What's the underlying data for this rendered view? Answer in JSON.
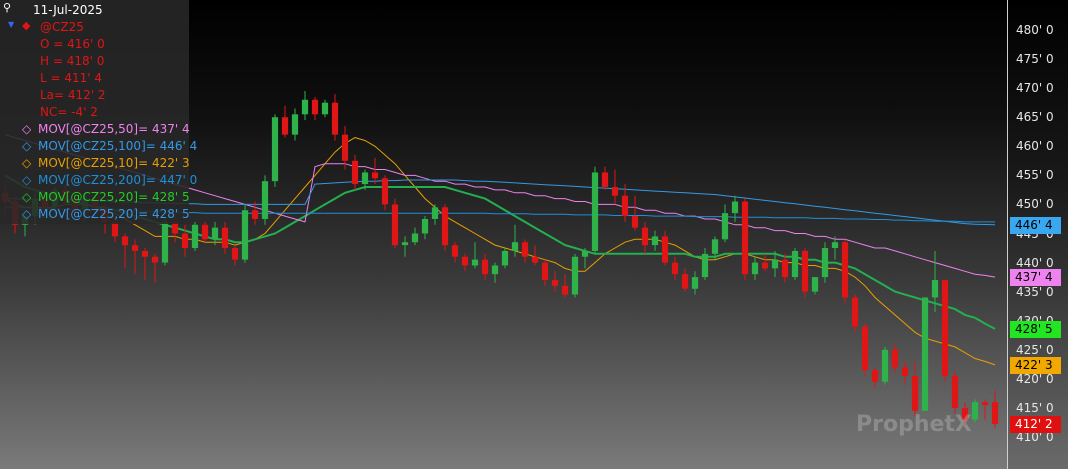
{
  "legend": {
    "date": "11-Jul-2025",
    "symbol": "@CZ25",
    "open": "O = 416' 0",
    "high": "H = 418' 0",
    "low": "L = 411' 4",
    "last": "La= 412' 2",
    "net_change": "NC= -4' 2",
    "studies": [
      {
        "label": "MOV[@CZ25,50]= 437' 4",
        "color": "#ee82ee"
      },
      {
        "label": "MOV[@CZ25,100]= 446' 4",
        "color": "#3399e6"
      },
      {
        "label": "MOV[@CZ25,10]= 422' 3",
        "color": "#e8a000"
      },
      {
        "label": "MOV[@CZ25,200]= 447' 0",
        "color": "#1e8fd8"
      },
      {
        "label": "MOV[@CZ25,20]= 428' 5",
        "color": "#22cc22"
      },
      {
        "label": "MOV[@CZ25,20]= 428' 5",
        "color": "#3399e6"
      }
    ]
  },
  "axis_tags": [
    {
      "text": "446' 4",
      "value": 446.5,
      "bg": "#3aa8f0",
      "fg": "#000000"
    },
    {
      "text": "437' 4",
      "value": 437.5,
      "bg": "#ee82ee",
      "fg": "#000000"
    },
    {
      "text": "428' 5",
      "value": 428.6,
      "bg": "#22e622",
      "fg": "#000000"
    },
    {
      "text": "422' 3",
      "value": 422.4,
      "bg": "#f2a800",
      "fg": "#000000"
    },
    {
      "text": "412' 2",
      "value": 412.25,
      "bg": "#e01010",
      "fg": "#ffffff"
    }
  ],
  "watermark": "ProphetX",
  "colors": {
    "up": "#2db34a",
    "down": "#e01515",
    "ma10": "#e8a000",
    "ma20": "#22b050",
    "ma50": "#ee82ee",
    "ma100": "#3399e6",
    "ma200": "#1e8fd8"
  },
  "chart_data": {
    "type": "candlestick",
    "symbol": "@CZ25",
    "ylim": [
      407,
      486
    ],
    "y_ticks": [
      "480' 0",
      "475' 0",
      "470' 0",
      "465' 0",
      "460' 0",
      "455' 0",
      "450' 0",
      "445' 0",
      "440' 0",
      "435' 0",
      "430' 0",
      "425' 0",
      "420' 0",
      "415' 0",
      "410' 0"
    ],
    "y_tick_values": [
      480,
      475,
      470,
      465,
      460,
      455,
      450,
      445,
      440,
      435,
      430,
      425,
      420,
      415,
      410
    ],
    "last_bar": {
      "date": "11-Jul-2025",
      "open": 416.0,
      "high": 418.0,
      "low": 411.5,
      "close": 412.25
    },
    "candles": [
      [
        452.0,
        454.0,
        448.0,
        450.5
      ],
      [
        450.5,
        451.5,
        445.0,
        446.5
      ],
      [
        446.5,
        449.0,
        444.5,
        448.0
      ],
      [
        448.0,
        452.0,
        446.5,
        451.0
      ],
      [
        451.0,
        452.5,
        449.0,
        449.5
      ],
      [
        449.5,
        453.0,
        448.5,
        452.5
      ],
      [
        452.5,
        453.5,
        450.0,
        451.0
      ],
      [
        451.0,
        451.5,
        448.0,
        449.0
      ],
      [
        449.0,
        452.0,
        447.0,
        451.0
      ],
      [
        451.0,
        451.5,
        447.5,
        449.5
      ],
      [
        449.5,
        450.0,
        445.0,
        447.0
      ],
      [
        447.0,
        448.0,
        443.5,
        444.5
      ],
      [
        444.5,
        445.0,
        439.0,
        443.0
      ],
      [
        443.0,
        444.0,
        438.0,
        442.0
      ],
      [
        442.0,
        442.5,
        437.0,
        441.0
      ],
      [
        441.0,
        441.5,
        436.5,
        440.0
      ],
      [
        440.0,
        447.5,
        439.5,
        447.0
      ],
      [
        447.0,
        448.5,
        443.5,
        445.0
      ],
      [
        445.0,
        446.5,
        441.0,
        442.5
      ],
      [
        442.5,
        447.0,
        442.0,
        446.5
      ],
      [
        446.5,
        447.0,
        443.5,
        444.0
      ],
      [
        444.0,
        447.0,
        443.0,
        446.0
      ],
      [
        446.0,
        447.0,
        441.5,
        442.5
      ],
      [
        442.5,
        443.0,
        439.5,
        440.5
      ],
      [
        440.5,
        450.0,
        440.0,
        449.0
      ],
      [
        449.0,
        450.5,
        446.5,
        447.5
      ],
      [
        447.5,
        455.0,
        446.5,
        454.0
      ],
      [
        454.0,
        465.5,
        453.0,
        465.0
      ],
      [
        465.0,
        467.0,
        461.5,
        462.0
      ],
      [
        462.0,
        466.5,
        461.0,
        465.5
      ],
      [
        465.5,
        469.5,
        464.5,
        468.0
      ],
      [
        468.0,
        468.5,
        464.5,
        465.5
      ],
      [
        465.5,
        468.0,
        465.0,
        467.5
      ],
      [
        467.5,
        469.0,
        461.0,
        462.0
      ],
      [
        462.0,
        463.5,
        456.0,
        457.5
      ],
      [
        457.5,
        458.5,
        452.5,
        453.5
      ],
      [
        453.5,
        456.0,
        452.5,
        455.5
      ],
      [
        455.5,
        458.0,
        453.5,
        454.5
      ],
      [
        454.5,
        455.0,
        449.0,
        450.0
      ],
      [
        450.0,
        451.0,
        442.5,
        443.0
      ],
      [
        443.0,
        444.5,
        441.0,
        443.5
      ],
      [
        443.5,
        446.0,
        443.0,
        445.0
      ],
      [
        445.0,
        448.0,
        444.0,
        447.5
      ],
      [
        447.5,
        450.0,
        446.5,
        449.5
      ],
      [
        449.5,
        450.0,
        442.0,
        443.0
      ],
      [
        443.0,
        443.5,
        440.0,
        441.0
      ],
      [
        441.0,
        441.5,
        438.5,
        439.5
      ],
      [
        439.5,
        443.5,
        439.0,
        440.5
      ],
      [
        440.5,
        441.5,
        437.0,
        438.0
      ],
      [
        438.0,
        440.0,
        436.5,
        439.5
      ],
      [
        439.5,
        442.5,
        439.0,
        442.0
      ],
      [
        442.0,
        446.5,
        441.0,
        443.5
      ],
      [
        443.5,
        444.0,
        440.0,
        441.0
      ],
      [
        441.0,
        443.0,
        439.5,
        440.0
      ],
      [
        440.0,
        440.5,
        436.0,
        437.0
      ],
      [
        437.0,
        438.5,
        435.0,
        436.0
      ],
      [
        436.0,
        438.0,
        434.0,
        434.5
      ],
      [
        434.5,
        441.5,
        434.0,
        441.0
      ],
      [
        441.0,
        442.5,
        439.0,
        442.0
      ],
      [
        442.0,
        456.5,
        441.5,
        455.5
      ],
      [
        455.5,
        456.5,
        452.5,
        453.0
      ],
      [
        453.0,
        456.0,
        450.0,
        451.5
      ],
      [
        451.5,
        453.5,
        447.0,
        448.0
      ],
      [
        448.0,
        451.5,
        445.5,
        446.0
      ],
      [
        446.0,
        447.0,
        441.5,
        443.0
      ],
      [
        443.0,
        445.5,
        442.0,
        444.5
      ],
      [
        444.5,
        445.5,
        439.5,
        440.0
      ],
      [
        440.0,
        441.0,
        437.0,
        438.0
      ],
      [
        438.0,
        439.0,
        435.0,
        435.5
      ],
      [
        435.5,
        438.5,
        434.5,
        437.5
      ],
      [
        437.5,
        442.5,
        437.0,
        441.5
      ],
      [
        441.5,
        444.5,
        440.5,
        444.0
      ],
      [
        444.0,
        450.0,
        443.5,
        448.5
      ],
      [
        448.5,
        451.5,
        447.0,
        450.5
      ],
      [
        450.5,
        451.0,
        437.0,
        438.0
      ],
      [
        438.0,
        441.0,
        437.0,
        440.0
      ],
      [
        440.0,
        441.5,
        438.5,
        439.0
      ],
      [
        439.0,
        442.0,
        437.5,
        440.5
      ],
      [
        440.5,
        441.5,
        436.5,
        437.5
      ],
      [
        437.5,
        442.5,
        437.0,
        442.0
      ],
      [
        442.0,
        442.5,
        434.0,
        435.0
      ],
      [
        435.0,
        437.5,
        434.5,
        437.5
      ],
      [
        437.5,
        443.5,
        436.5,
        442.5
      ],
      [
        442.5,
        444.5,
        440.5,
        443.5
      ],
      [
        443.5,
        444.0,
        433.0,
        434.0
      ],
      [
        434.0,
        434.5,
        428.0,
        429.0
      ],
      [
        429.0,
        429.5,
        420.5,
        421.5
      ],
      [
        421.5,
        422.0,
        418.5,
        419.5
      ],
      [
        419.5,
        425.5,
        419.0,
        425.0
      ],
      [
        425.0,
        426.0,
        421.0,
        422.0
      ],
      [
        422.0,
        423.0,
        419.0,
        420.5
      ],
      [
        420.5,
        423.0,
        413.5,
        414.5
      ],
      [
        414.5,
        432.5,
        416.5,
        434.0
      ],
      [
        434.0,
        442.0,
        431.5,
        437.0
      ],
      [
        437.0,
        429.0,
        419.5,
        420.5
      ],
      [
        420.5,
        421.5,
        414.0,
        415.0
      ],
      [
        415.0,
        416.0,
        412.0,
        413.0
      ],
      [
        413.0,
        416.5,
        412.5,
        416.0
      ],
      [
        416.0,
        416.5,
        413.0,
        415.5
      ],
      [
        416.0,
        418.0,
        411.5,
        412.25
      ]
    ],
    "series": [
      {
        "name": "MOV[@CZ25,10]",
        "values": [
          451.0,
          450.0,
          449.5,
          449.5,
          449.5,
          449.5,
          450.0,
          450.0,
          450.0,
          449.5,
          449.0,
          448.5,
          447.5,
          446.5,
          445.5,
          444.5,
          444.5,
          444.5,
          444.0,
          444.0,
          443.5,
          443.5,
          443.5,
          443.0,
          443.5,
          444.0,
          445.0,
          447.0,
          449.0,
          451.0,
          453.0,
          455.0,
          457.0,
          459.0,
          460.5,
          461.5,
          461.0,
          460.0,
          458.5,
          457.0,
          455.0,
          453.0,
          451.0,
          449.5,
          448.0,
          447.0,
          446.0,
          445.0,
          444.0,
          443.0,
          442.5,
          442.0,
          441.5,
          441.0,
          440.5,
          440.0,
          439.0,
          438.5,
          438.5,
          440.0,
          441.5,
          442.5,
          443.5,
          444.0,
          444.0,
          444.0,
          443.5,
          443.0,
          442.0,
          441.0,
          440.5,
          440.5,
          441.0,
          441.5,
          441.5,
          441.0,
          440.5,
          440.5,
          440.0,
          440.0,
          439.5,
          439.5,
          439.0,
          439.0,
          438.5,
          437.5,
          436.0,
          434.0,
          432.5,
          431.0,
          429.5,
          428.0,
          427.0,
          426.5,
          426.0,
          425.5,
          424.5,
          423.5,
          423.0,
          422.4
        ]
      },
      {
        "name": "MOV[@CZ25,20]",
        "values": [
          455.0,
          454.0,
          453.0,
          452.5,
          452.0,
          451.5,
          451.0,
          450.5,
          450.0,
          449.5,
          449.5,
          449.0,
          448.5,
          448.0,
          447.5,
          447.0,
          446.5,
          446.0,
          445.5,
          445.0,
          444.5,
          444.0,
          444.0,
          443.5,
          443.5,
          444.0,
          444.5,
          445.0,
          446.0,
          447.0,
          448.0,
          449.0,
          450.0,
          451.0,
          452.0,
          452.5,
          453.0,
          453.0,
          453.0,
          453.0,
          453.0,
          453.0,
          453.0,
          453.0,
          453.0,
          452.5,
          452.0,
          451.5,
          451.0,
          450.0,
          449.0,
          448.0,
          447.0,
          446.0,
          445.0,
          444.0,
          443.0,
          442.5,
          442.0,
          441.5,
          441.5,
          441.5,
          441.5,
          441.5,
          441.5,
          441.5,
          441.5,
          441.5,
          441.5,
          441.0,
          441.0,
          441.0,
          441.5,
          441.5,
          441.5,
          441.5,
          441.5,
          441.5,
          441.0,
          441.0,
          440.5,
          440.5,
          440.0,
          440.0,
          439.5,
          439.0,
          438.0,
          437.0,
          436.0,
          435.0,
          434.5,
          434.0,
          433.5,
          433.0,
          432.5,
          432.0,
          431.0,
          430.5,
          429.5,
          428.6
        ]
      },
      {
        "name": "MOV[@CZ25,50]",
        "values": [
          462.0,
          461.5,
          461.0,
          460.5,
          460.0,
          459.5,
          459.0,
          458.5,
          458.0,
          457.5,
          457.0,
          456.5,
          456.0,
          455.5,
          455.0,
          454.5,
          454.0,
          453.5,
          453.0,
          452.5,
          452.0,
          451.5,
          451.0,
          450.5,
          450.0,
          449.5,
          449.0,
          448.5,
          448.0,
          447.5,
          447.0,
          456.5,
          457.0,
          457.0,
          457.0,
          456.5,
          456.5,
          456.0,
          456.0,
          455.5,
          455.0,
          455.0,
          454.5,
          454.0,
          454.0,
          453.5,
          453.5,
          453.0,
          453.0,
          452.5,
          452.5,
          452.0,
          452.0,
          451.5,
          451.5,
          451.0,
          451.0,
          450.5,
          450.5,
          450.0,
          450.0,
          450.0,
          449.5,
          449.5,
          449.0,
          449.0,
          448.5,
          448.5,
          448.0,
          448.0,
          447.5,
          447.5,
          447.0,
          446.5,
          446.5,
          446.0,
          446.0,
          445.5,
          445.5,
          445.0,
          445.0,
          444.5,
          444.5,
          444.0,
          444.0,
          443.5,
          443.0,
          442.5,
          442.5,
          442.0,
          441.5,
          441.0,
          440.5,
          440.0,
          439.5,
          439.0,
          438.5,
          438.0,
          437.8,
          437.5
        ]
      },
      {
        "name": "MOV[@CZ25,100]",
        "values": [
          451.0,
          451.0,
          450.9,
          450.9,
          450.8,
          450.8,
          450.7,
          450.7,
          450.6,
          450.6,
          450.5,
          450.5,
          450.4,
          450.4,
          450.3,
          450.3,
          450.2,
          450.2,
          450.1,
          450.1,
          450.0,
          450.0,
          450.0,
          450.0,
          450.0,
          450.0,
          450.0,
          450.0,
          450.0,
          450.0,
          450.0,
          453.5,
          453.6,
          453.7,
          453.8,
          453.9,
          454.0,
          454.0,
          454.1,
          454.1,
          454.2,
          454.2,
          454.2,
          454.2,
          454.2,
          454.2,
          454.1,
          454.0,
          454.0,
          453.9,
          453.8,
          453.7,
          453.6,
          453.5,
          453.4,
          453.3,
          453.2,
          453.1,
          453.0,
          452.9,
          452.8,
          452.7,
          452.6,
          452.5,
          452.4,
          452.3,
          452.2,
          452.1,
          452.0,
          451.9,
          451.8,
          451.7,
          451.5,
          451.3,
          451.1,
          450.9,
          450.7,
          450.5,
          450.3,
          450.1,
          449.9,
          449.7,
          449.5,
          449.3,
          449.1,
          448.9,
          448.7,
          448.5,
          448.3,
          448.1,
          447.9,
          447.7,
          447.5,
          447.3,
          447.1,
          446.9,
          446.7,
          446.6,
          446.55,
          446.5
        ]
      },
      {
        "name": "MOV[@CZ25,200]",
        "values": [
          449.5,
          449.5,
          449.4,
          449.4,
          449.3,
          449.3,
          449.2,
          449.2,
          449.1,
          449.1,
          449.0,
          449.0,
          448.9,
          448.9,
          448.8,
          448.8,
          448.7,
          448.7,
          448.6,
          448.6,
          448.5,
          448.5,
          448.5,
          448.5,
          448.5,
          448.5,
          448.5,
          448.5,
          448.5,
          448.5,
          448.5,
          448.5,
          448.5,
          448.5,
          448.5,
          448.5,
          448.5,
          448.5,
          448.5,
          448.5,
          448.5,
          448.5,
          448.5,
          448.5,
          448.5,
          448.5,
          448.5,
          448.5,
          448.5,
          448.4,
          448.4,
          448.4,
          448.4,
          448.3,
          448.3,
          448.3,
          448.3,
          448.2,
          448.2,
          448.2,
          448.2,
          448.1,
          448.1,
          448.1,
          448.1,
          448.0,
          448.0,
          448.0,
          448.0,
          447.9,
          447.9,
          447.9,
          447.9,
          447.8,
          447.8,
          447.8,
          447.8,
          447.7,
          447.7,
          447.7,
          447.7,
          447.6,
          447.6,
          447.6,
          447.5,
          447.5,
          447.5,
          447.4,
          447.4,
          447.3,
          447.3,
          447.2,
          447.2,
          447.1,
          447.1,
          447.1,
          447.0,
          447.0,
          447.0,
          447.0
        ]
      }
    ]
  }
}
